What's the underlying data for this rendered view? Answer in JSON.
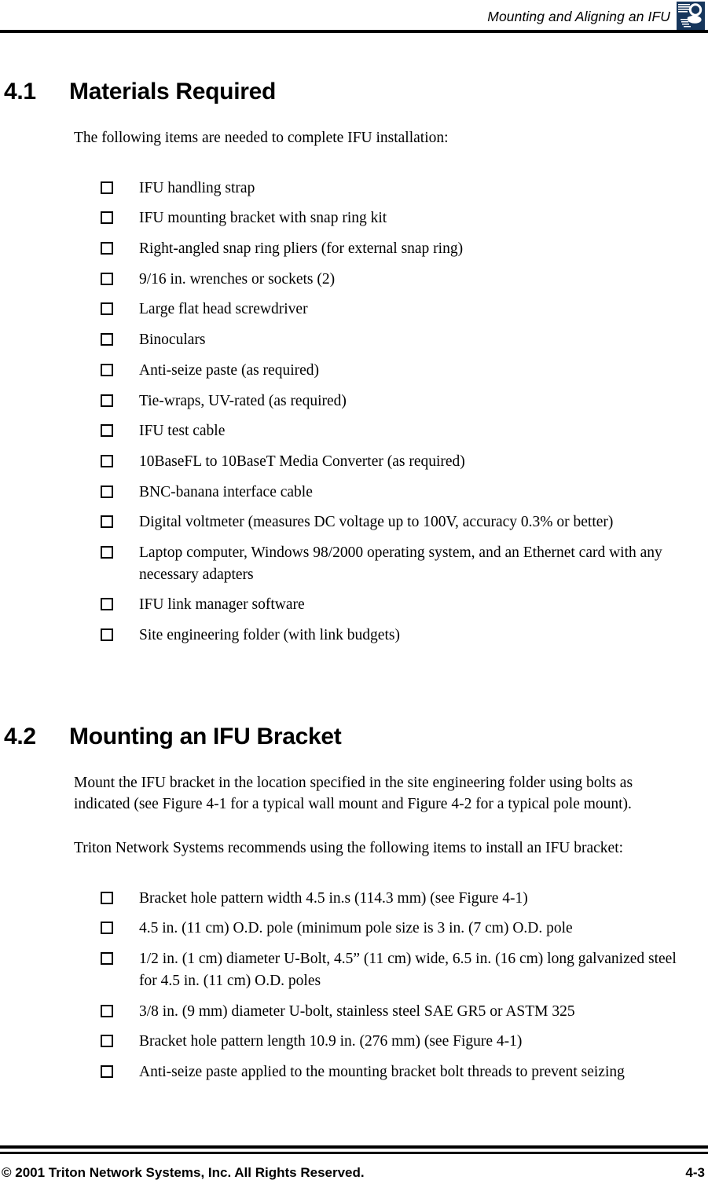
{
  "header": {
    "title": "Mounting and Aligning an IFU",
    "logo_color": "#16365c",
    "logo_name": "triton-network-systems-logo"
  },
  "sections": [
    {
      "number": "4.1",
      "title": "Materials Required",
      "intro": "The following items are needed to complete IFU installation:",
      "items": [
        "IFU handling strap",
        "IFU mounting bracket with snap ring kit",
        "Right-angled snap ring pliers (for external snap ring)",
        "9/16 in. wrenches or sockets (2)",
        "Large flat head screwdriver",
        "Binoculars",
        "Anti-seize paste (as required)",
        "Tie-wraps, UV-rated (as required)",
        "IFU test cable",
        "10BaseFL to 10BaseT Media Converter (as required)",
        "BNC-banana interface cable",
        "Digital voltmeter (measures DC voltage up to 100V, accuracy 0.3% or better)",
        "Laptop computer, Windows 98/2000 operating system, and an Ethernet card with any necessary adapters",
        "IFU link manager software",
        "Site engineering folder (with link budgets)"
      ]
    },
    {
      "number": "4.2",
      "title": "Mounting an IFU Bracket",
      "para1": "Mount the IFU bracket in the location specified in the site engineering folder using bolts as indicated (see Figure 4-1 for a typical wall mount and Figure 4-2 for a typical pole mount).",
      "para2": "Triton Network Systems recommends using the following items to install an IFU bracket:",
      "items": [
        "Bracket hole pattern width 4.5 in.s (114.3 mm) (see Figure 4-1)",
        "4.5 in. (11 cm) O.D. pole (minimum pole size is 3 in. (7 cm) O.D. pole",
        "1/2 in. (1 cm) diameter U-Bolt, 4.5” (11 cm) wide, 6.5 in. (16 cm) long galvanized steel for 4.5 in. (11 cm) O.D. poles",
        "3/8 in. (9 mm) diameter U-bolt, stainless steel SAE GR5 or ASTM 325",
        "Bracket hole pattern length 10.9 in. (276 mm) (see Figure 4-1)",
        "Anti-seize paste applied to the mounting bracket bolt threads to prevent seizing"
      ]
    }
  ],
  "footer": {
    "copyright": "© 2001 Triton Network Systems, Inc. All Rights Reserved.",
    "page_number": "4-3"
  }
}
